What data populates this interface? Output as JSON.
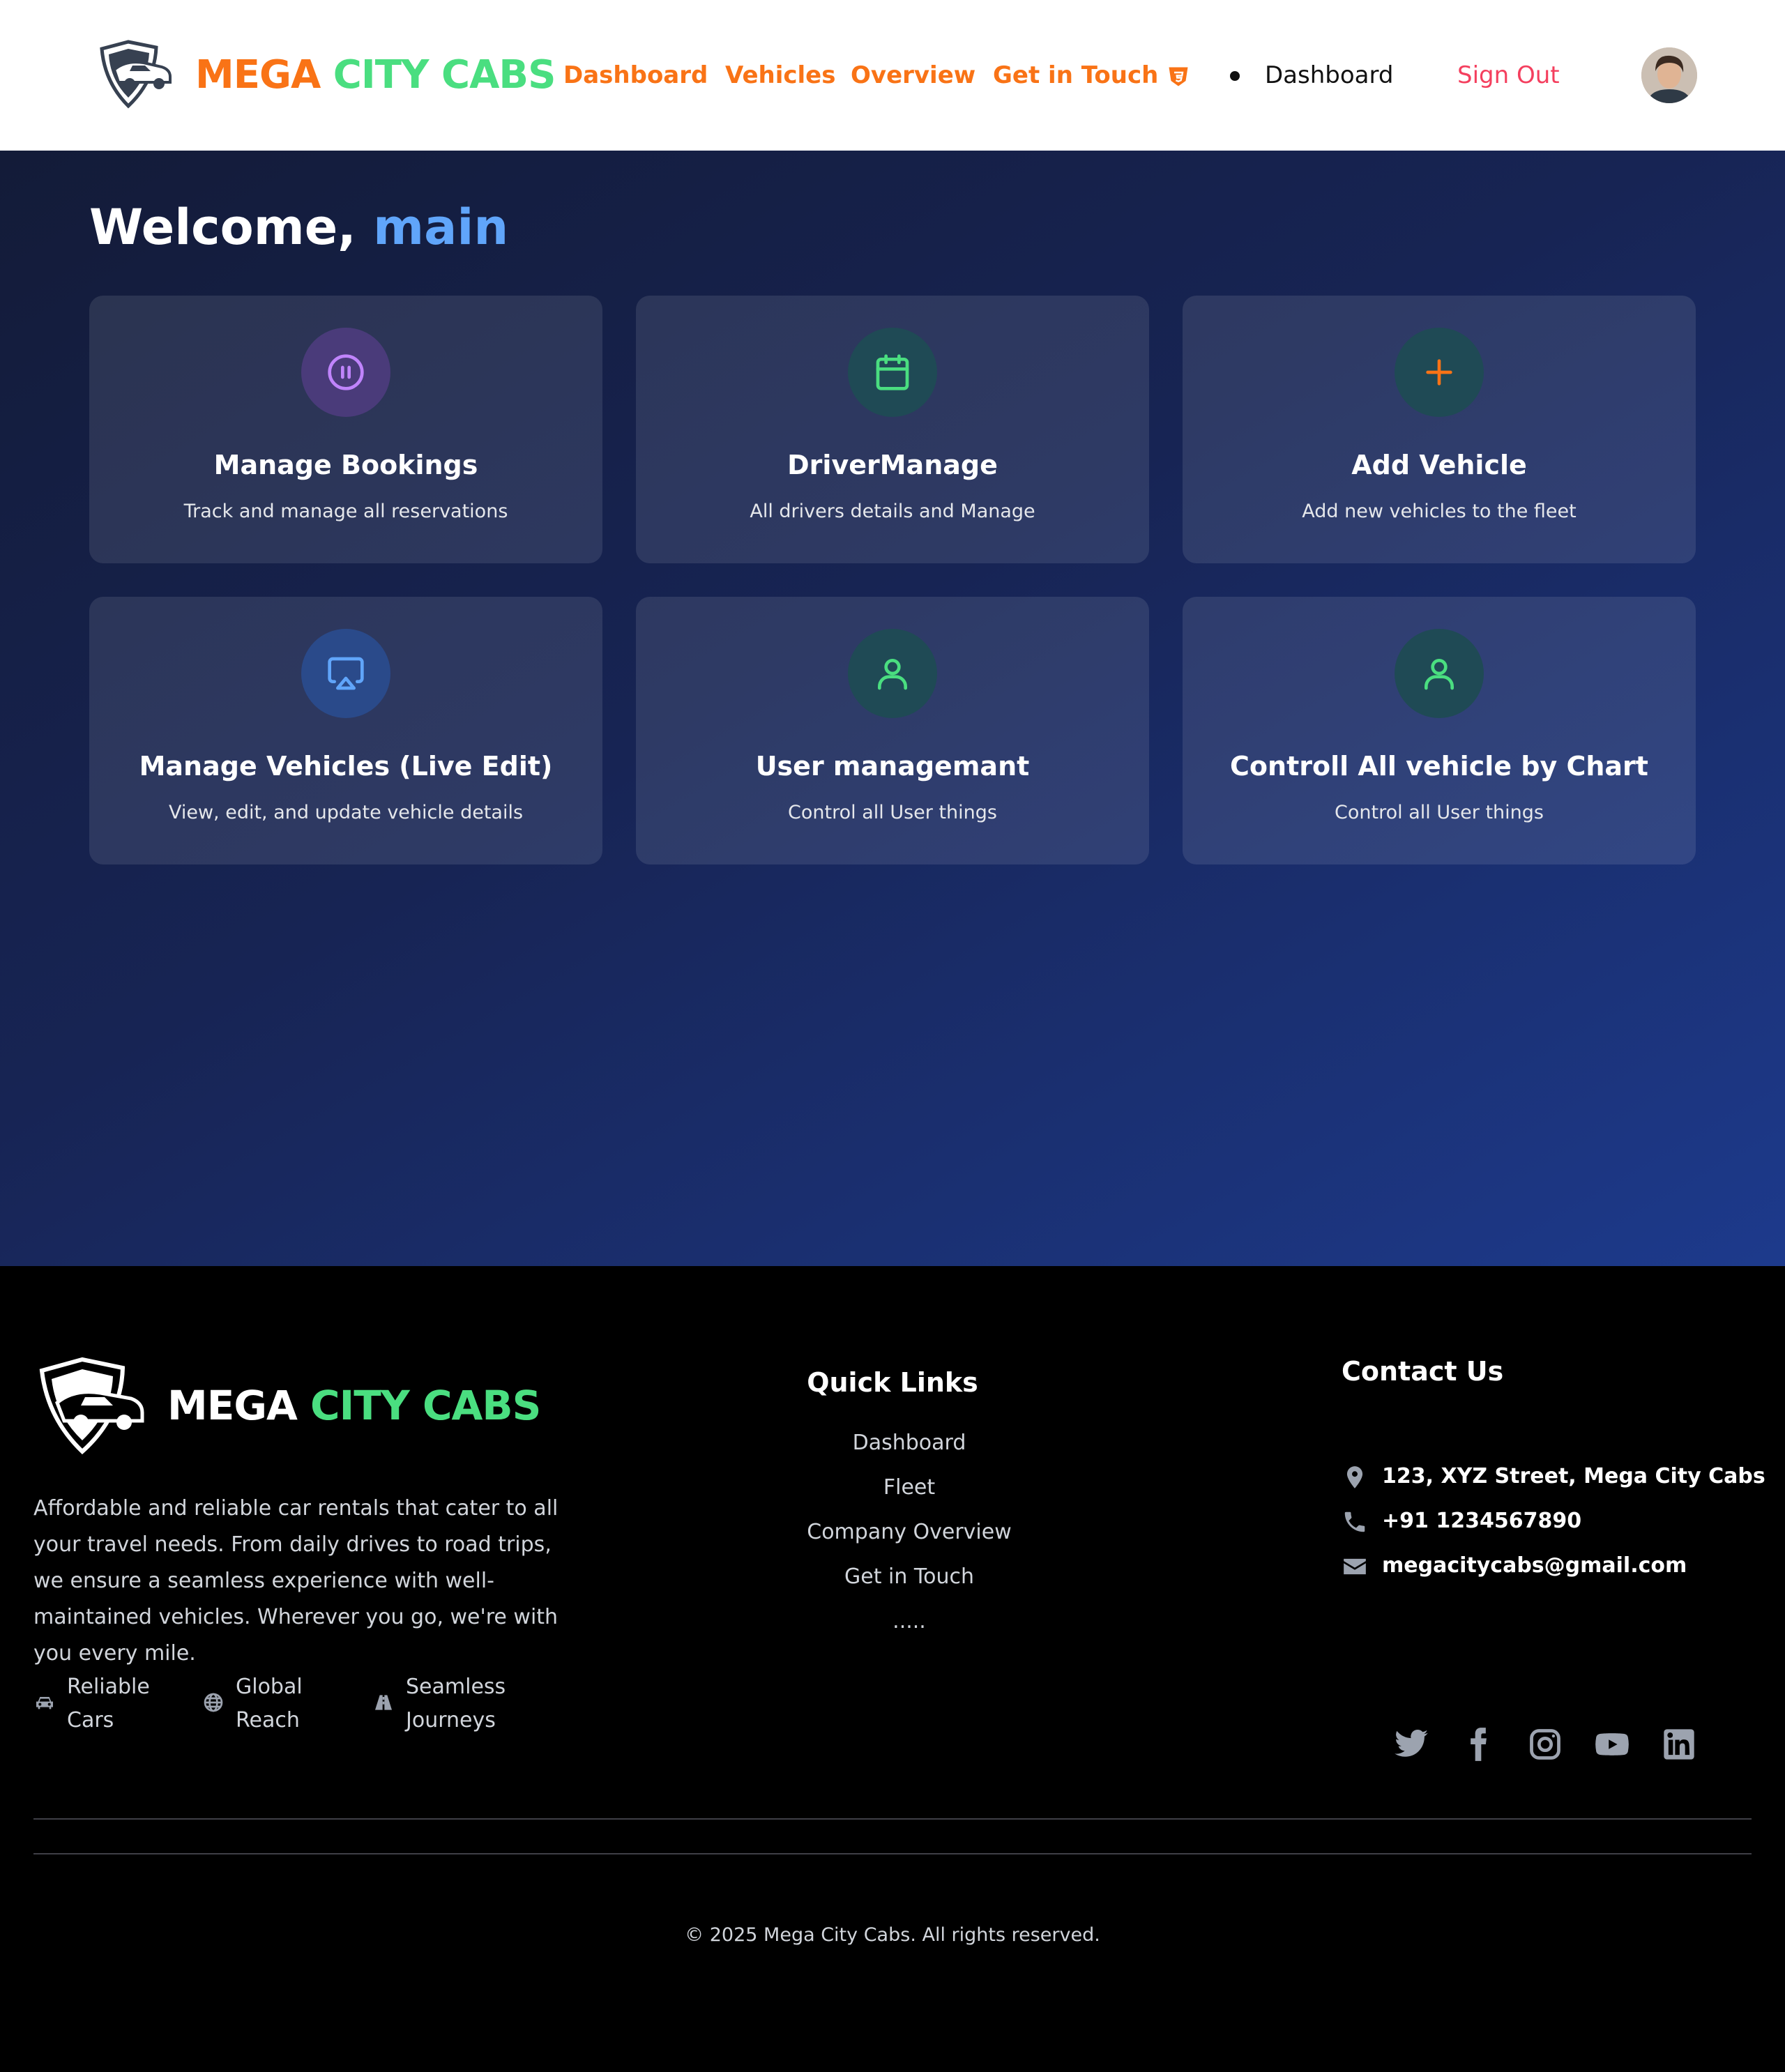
{
  "header": {
    "brand_part1": "MEGA",
    "brand_part2": "CITY CABS",
    "nav": [
      "Dashboard",
      "Vehicles",
      "Overview",
      "Get in Touch"
    ],
    "current_page": "Dashboard",
    "sign_out": "Sign Out",
    "icons": {
      "logo": "car-shield-logo",
      "nav_extra": "shield-icon",
      "avatar": "user-avatar"
    }
  },
  "hero": {
    "welcome_prefix": "Welcome,",
    "welcome_name": "main",
    "cards": [
      {
        "title": "Manage Bookings",
        "description": "Track and manage all reservations",
        "icon": "pause-circle-icon",
        "icon_color": "#c084fc"
      },
      {
        "title": "DriverManage",
        "description": "All drivers details and Manage",
        "icon": "calendar-icon",
        "icon_color": "#4ade80"
      },
      {
        "title": "Add Vehicle",
        "description": "Add new vehicles to the fleet",
        "icon": "plus-icon",
        "icon_color": "#f97316"
      },
      {
        "title": "Manage Vehicles (Live Edit)",
        "description": "View, edit, and update vehicle details",
        "icon": "cast-icon",
        "icon_color": "#60a5fa"
      },
      {
        "title": "User managemant",
        "description": "Control all User things",
        "icon": "user-icon",
        "icon_color": "#4ade80"
      },
      {
        "title": "Controll All vehicle by Chart",
        "description": "Control all User things",
        "icon": "user-icon",
        "icon_color": "#4ade80"
      }
    ]
  },
  "footer": {
    "brand_part1": "MEGA",
    "brand_part2": "CITY CABS",
    "about": "Affordable and reliable car rentals that cater to all your travel needs. From daily drives to road trips, we ensure a seamless experience with well-maintained vehicles. Wherever you go, we're with you every mile.",
    "features": [
      {
        "label": "Reliable Cars",
        "icon": "car-icon"
      },
      {
        "label": "Global Reach",
        "icon": "globe-icon"
      },
      {
        "label": "Seamless Journeys",
        "icon": "road-icon"
      }
    ],
    "quick_links_title": "Quick Links",
    "quick_links": [
      "Dashboard",
      "Fleet",
      "Company Overview",
      "Get in Touch",
      "....."
    ],
    "contact_title": "Contact Us",
    "contact": {
      "address": "123, XYZ Street, Mega City Cabs",
      "phone": "+91 1234567890",
      "email": "megacitycabs@gmail.com"
    },
    "social": [
      "twitter-icon",
      "facebook-icon",
      "instagram-icon",
      "youtube-icon",
      "linkedin-icon"
    ],
    "copyright": "© 2025 Mega City Cabs. All rights reserved."
  },
  "colors": {
    "accent_orange": "#f97316",
    "accent_green": "#4ade80",
    "accent_blue": "#60a5fa",
    "sign_out": "#f43f5e",
    "footer_bg": "#000000"
  }
}
